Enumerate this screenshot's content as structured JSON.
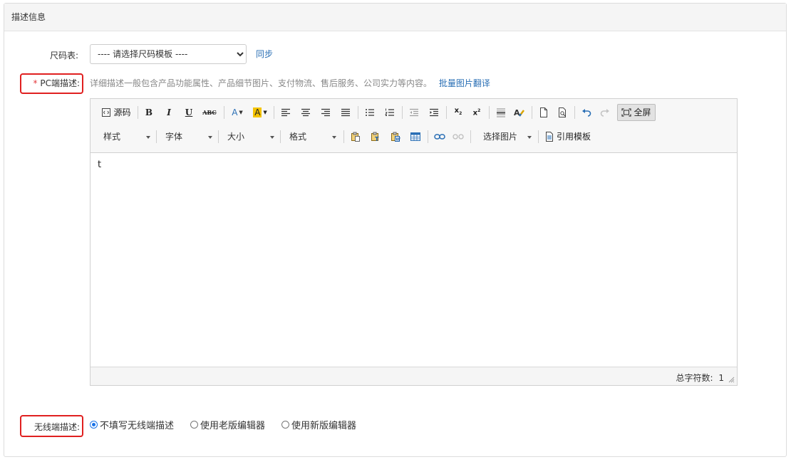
{
  "panel": {
    "title": "描述信息"
  },
  "size_chart": {
    "label": "尺码表:",
    "select_value": "---- 请选择尺码模板 ----",
    "sync_link": "同步"
  },
  "pc_desc": {
    "required_mark": "*",
    "label": "PC端描述:",
    "hint": "详细描述一般包含产品功能属性、产品细节图片、支付物流、售后服务、公司实力等内容。",
    "batch_translate_link": "批量图片翻译"
  },
  "editor": {
    "toolbar_row1": {
      "source_label": "源码",
      "bold": "B",
      "italic": "I",
      "underline": "U",
      "strike": "ABC",
      "font_color": "A",
      "bg_color": "A",
      "fullscreen_label": "全屏"
    },
    "toolbar_row2": {
      "style_combo": "样式",
      "font_combo": "字体",
      "size_combo": "大小",
      "format_combo": "格式",
      "choose_image": "选择图片",
      "cite_template": "引用模板"
    },
    "content": "t",
    "word_count_label": "总字符数:",
    "word_count": "1"
  },
  "mobile_desc": {
    "label": "无线端描述:",
    "options": [
      "不填写无线端描述",
      "使用老版编辑器",
      "使用新版编辑器"
    ],
    "selected_index": 0
  },
  "colors": {
    "accent": "#2a6fb5",
    "required": "#e4393c",
    "highlight_box": "#e02020",
    "radio_on": "#1a73e8",
    "bg_yellow": "#f5c400"
  }
}
